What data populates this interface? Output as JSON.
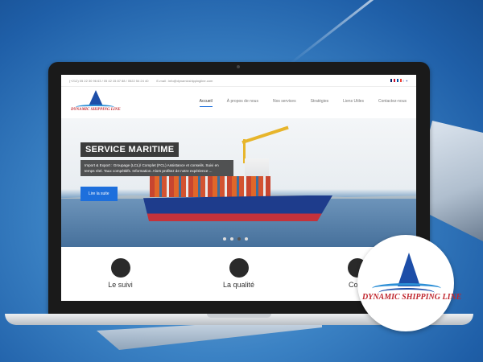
{
  "topbar": {
    "phone": "(+212) 05 22 30 96 63 / 05 42 15 87 88 / 0522 54 24 40",
    "email": "E-mail : info@dynamicshippingline.com"
  },
  "logo": {
    "text": "DYNAMIC SHIPPING LINE"
  },
  "menu": {
    "items": [
      {
        "label": "Accueil"
      },
      {
        "label": "À propos de nous"
      },
      {
        "label": "Nos services"
      },
      {
        "label": "Stratégies"
      },
      {
        "label": "Liens Utiles"
      },
      {
        "label": "Contactez-nous"
      }
    ]
  },
  "hero": {
    "title": "SERVICE MARITIME",
    "description": "Import & Export : Groupage (LCL)/ Complet (FCL) Assistance et conseils. Suivi en temps réel. Taux compétitifs. Information. Alors profitez de notre expérience ...",
    "button": "Lire la suite"
  },
  "features": [
    {
      "label": "Le suivi"
    },
    {
      "label": "La qualité"
    },
    {
      "label": "Cons"
    }
  ],
  "badge": {
    "text": "DYNAMIC SHIPPING LINE"
  },
  "colors": {
    "accent": "#1d6fdc",
    "logo_red": "#c0262e",
    "logo_blue": "#1d4ea8"
  }
}
